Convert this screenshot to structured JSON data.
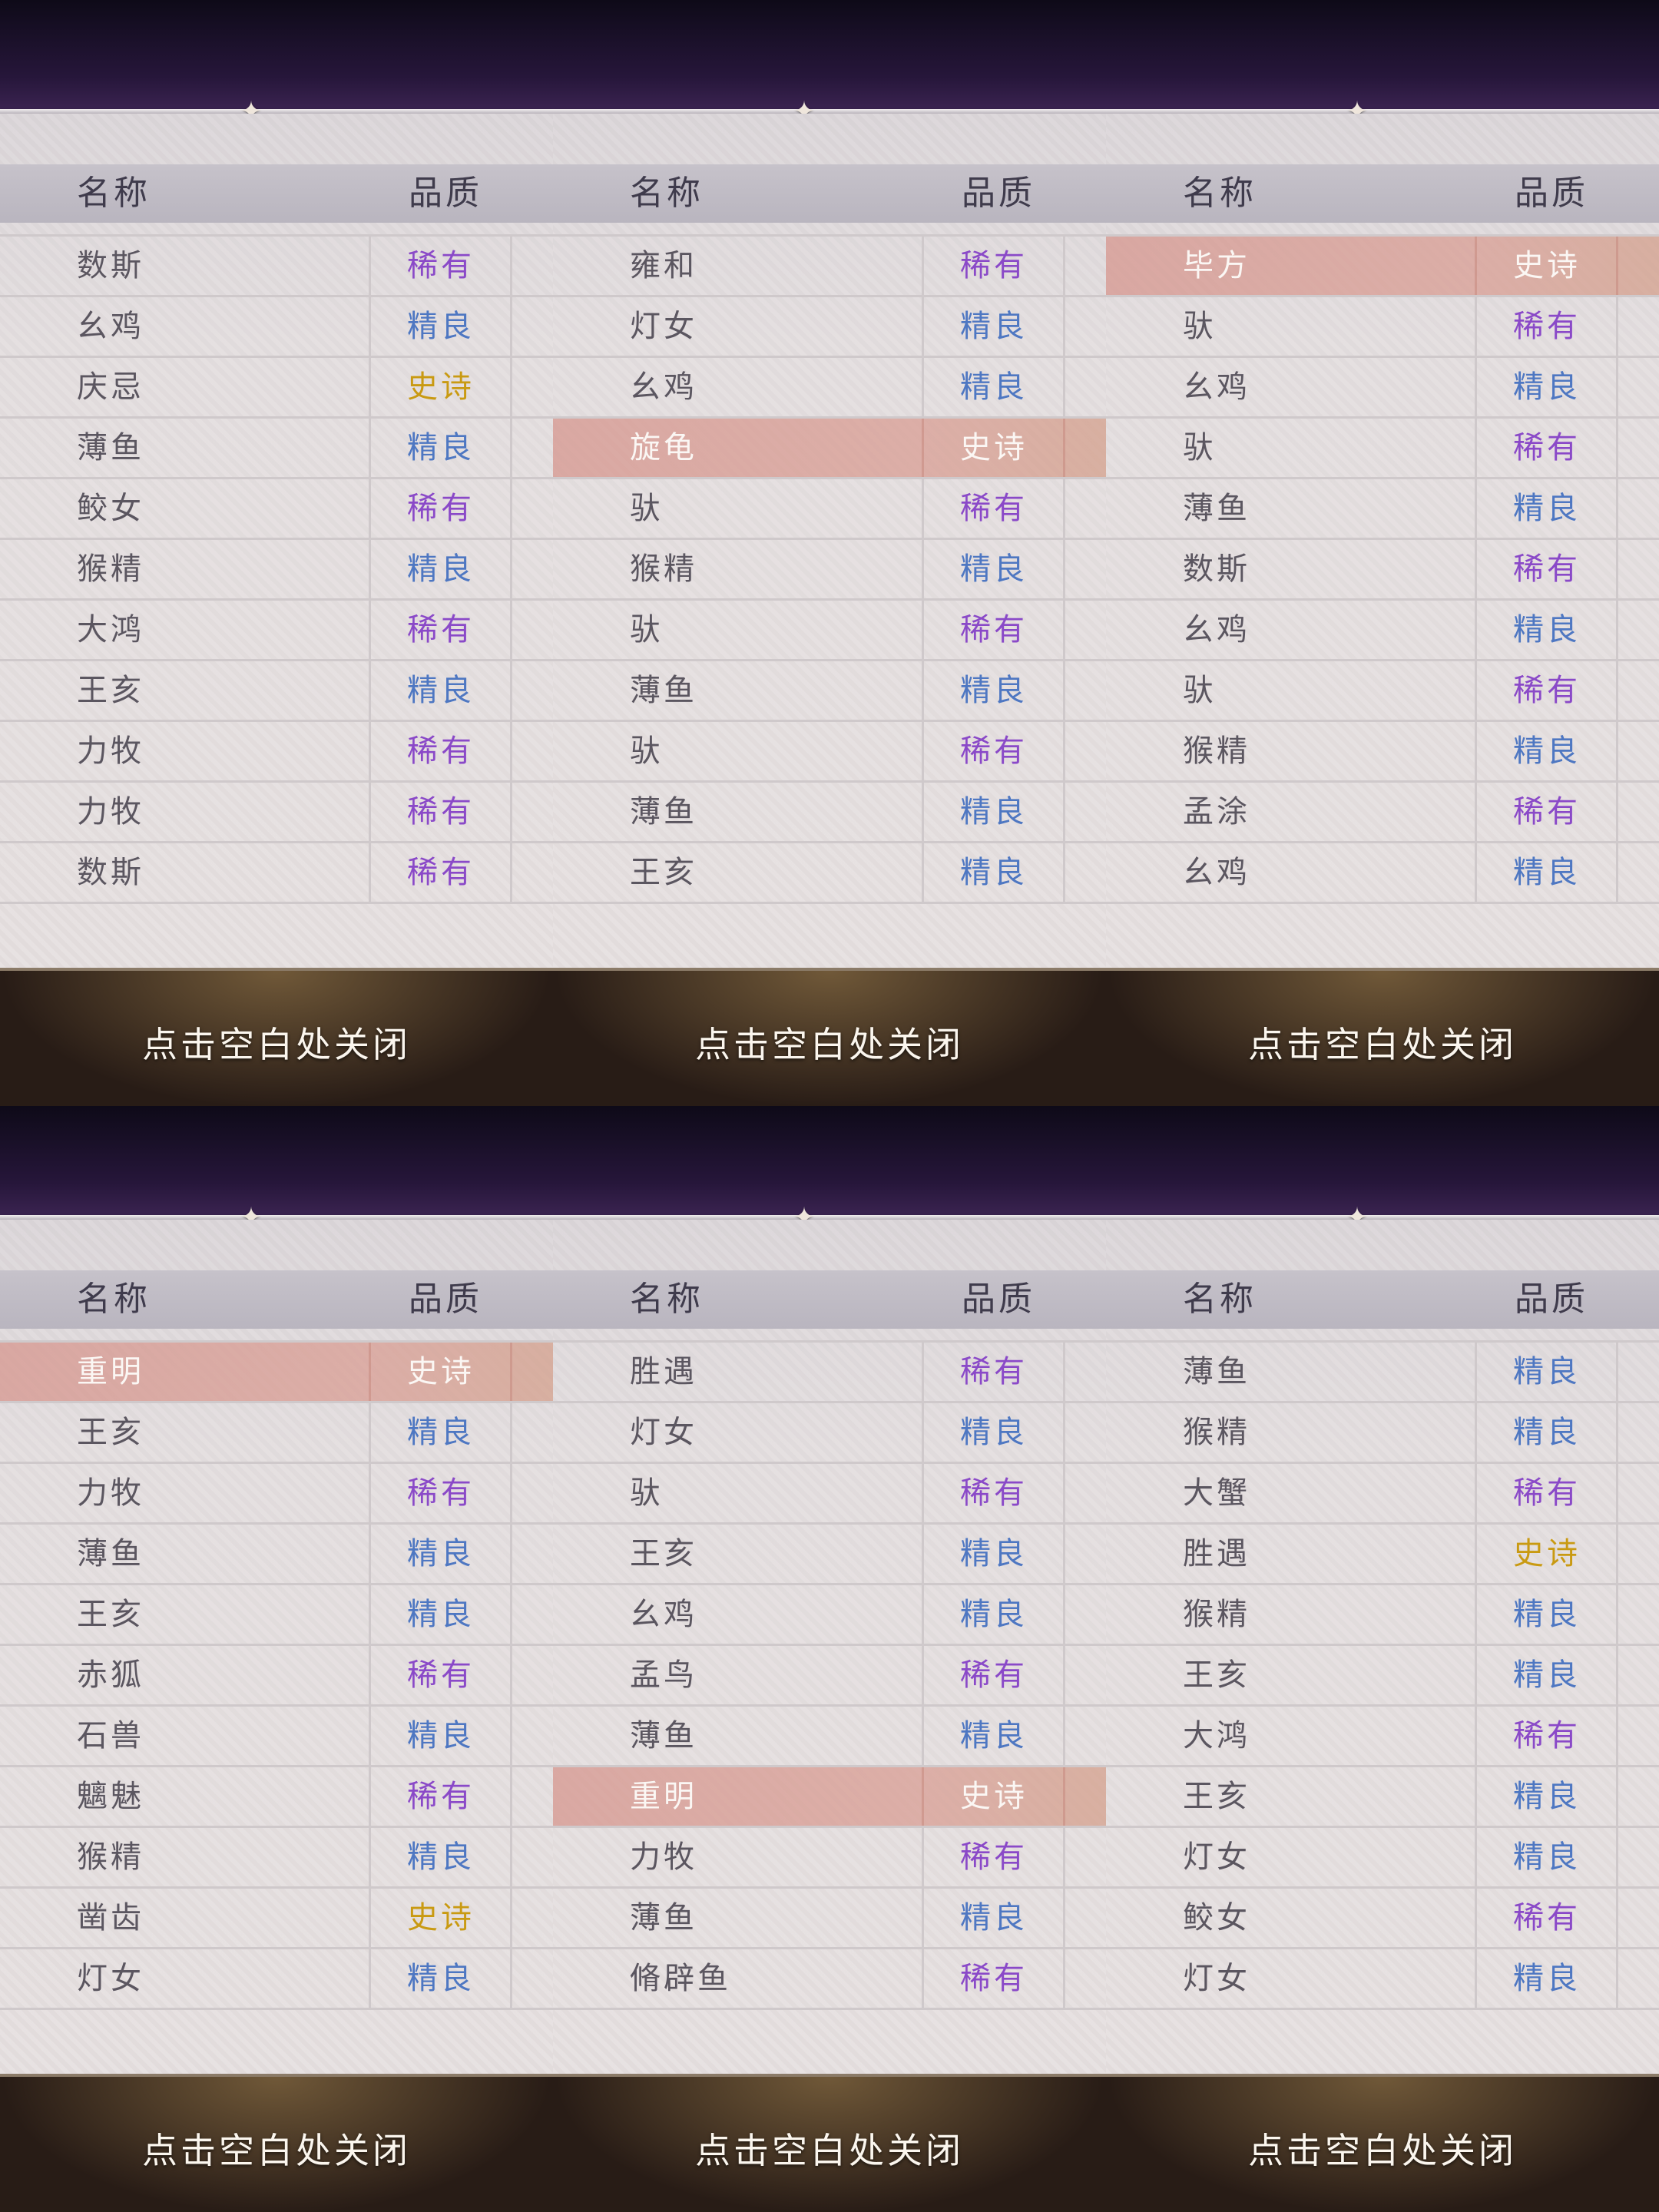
{
  "header": {
    "name": "名称",
    "quality": "品质"
  },
  "close_hint": "点击空白处关闭",
  "quality_classes": {
    "史诗": "q-epic",
    "稀有": "q-rare",
    "精良": "q-good"
  },
  "ornament_icon": "✦",
  "panels": [
    {
      "rows": [
        {
          "name": "数斯",
          "quality": "稀有"
        },
        {
          "name": "幺鸡",
          "quality": "精良"
        },
        {
          "name": "庆忌",
          "quality": "史诗"
        },
        {
          "name": "薄鱼",
          "quality": "精良"
        },
        {
          "name": "鲛女",
          "quality": "稀有"
        },
        {
          "name": "猴精",
          "quality": "精良"
        },
        {
          "name": "大鸿",
          "quality": "稀有"
        },
        {
          "name": "王亥",
          "quality": "精良"
        },
        {
          "name": "力牧",
          "quality": "稀有"
        },
        {
          "name": "力牧",
          "quality": "稀有"
        },
        {
          "name": "数斯",
          "quality": "稀有"
        }
      ]
    },
    {
      "rows": [
        {
          "name": "雍和",
          "quality": "稀有"
        },
        {
          "name": "灯女",
          "quality": "精良"
        },
        {
          "name": "幺鸡",
          "quality": "精良"
        },
        {
          "name": "旋龟",
          "quality": "史诗",
          "highlight": true
        },
        {
          "name": "驮",
          "quality": "稀有"
        },
        {
          "name": "猴精",
          "quality": "精良"
        },
        {
          "name": "驮",
          "quality": "稀有"
        },
        {
          "name": "薄鱼",
          "quality": "精良"
        },
        {
          "name": "驮",
          "quality": "稀有"
        },
        {
          "name": "薄鱼",
          "quality": "精良"
        },
        {
          "name": "王亥",
          "quality": "精良"
        }
      ]
    },
    {
      "rows": [
        {
          "name": "毕方",
          "quality": "史诗",
          "highlight": true
        },
        {
          "name": "驮",
          "quality": "稀有"
        },
        {
          "name": "幺鸡",
          "quality": "精良"
        },
        {
          "name": "驮",
          "quality": "稀有"
        },
        {
          "name": "薄鱼",
          "quality": "精良"
        },
        {
          "name": "数斯",
          "quality": "稀有"
        },
        {
          "name": "幺鸡",
          "quality": "精良"
        },
        {
          "name": "驮",
          "quality": "稀有"
        },
        {
          "name": "猴精",
          "quality": "精良"
        },
        {
          "name": "孟涂",
          "quality": "稀有"
        },
        {
          "name": "幺鸡",
          "quality": "精良"
        }
      ]
    },
    {
      "rows": [
        {
          "name": "重明",
          "quality": "史诗",
          "highlight": true
        },
        {
          "name": "王亥",
          "quality": "精良"
        },
        {
          "name": "力牧",
          "quality": "稀有"
        },
        {
          "name": "薄鱼",
          "quality": "精良"
        },
        {
          "name": "王亥",
          "quality": "精良"
        },
        {
          "name": "赤狐",
          "quality": "稀有"
        },
        {
          "name": "石兽",
          "quality": "精良"
        },
        {
          "name": "魑魅",
          "quality": "稀有"
        },
        {
          "name": "猴精",
          "quality": "精良"
        },
        {
          "name": "凿齿",
          "quality": "史诗"
        },
        {
          "name": "灯女",
          "quality": "精良"
        }
      ]
    },
    {
      "rows": [
        {
          "name": "胜遇",
          "quality": "稀有"
        },
        {
          "name": "灯女",
          "quality": "精良"
        },
        {
          "name": "驮",
          "quality": "稀有"
        },
        {
          "name": "王亥",
          "quality": "精良"
        },
        {
          "name": "幺鸡",
          "quality": "精良"
        },
        {
          "name": "孟鸟",
          "quality": "稀有"
        },
        {
          "name": "薄鱼",
          "quality": "精良"
        },
        {
          "name": "重明",
          "quality": "史诗",
          "highlight": true
        },
        {
          "name": "力牧",
          "quality": "稀有"
        },
        {
          "name": "薄鱼",
          "quality": "精良"
        },
        {
          "name": "脩辟鱼",
          "quality": "稀有"
        }
      ]
    },
    {
      "rows": [
        {
          "name": "薄鱼",
          "quality": "精良"
        },
        {
          "name": "猴精",
          "quality": "精良"
        },
        {
          "name": "大蟹",
          "quality": "稀有"
        },
        {
          "name": "胜遇",
          "quality": "史诗"
        },
        {
          "name": "猴精",
          "quality": "精良"
        },
        {
          "name": "王亥",
          "quality": "精良"
        },
        {
          "name": "大鸿",
          "quality": "稀有"
        },
        {
          "name": "王亥",
          "quality": "精良"
        },
        {
          "name": "灯女",
          "quality": "精良"
        },
        {
          "name": "鲛女",
          "quality": "稀有"
        },
        {
          "name": "灯女",
          "quality": "精良"
        }
      ]
    }
  ]
}
